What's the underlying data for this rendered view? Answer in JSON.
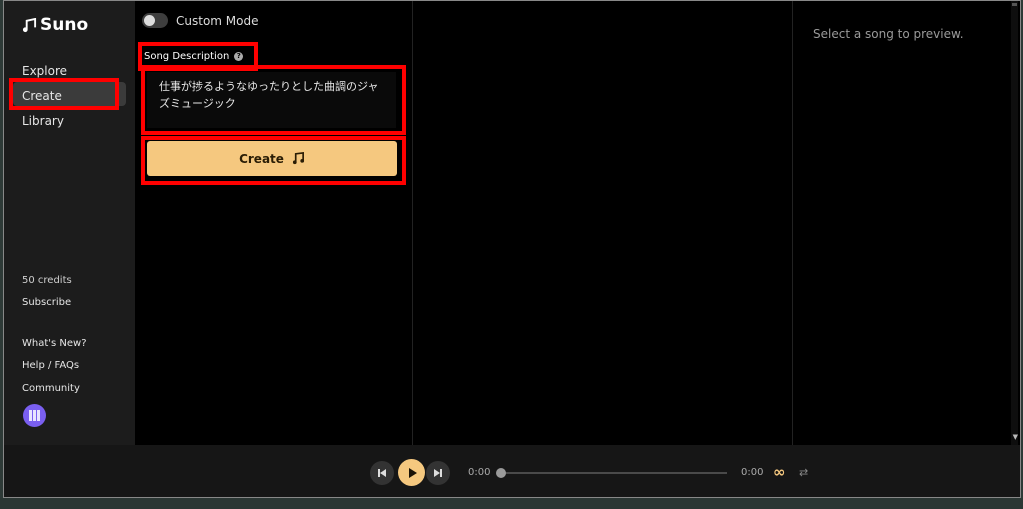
{
  "app": {
    "name": "Suno"
  },
  "sidebar": {
    "items": [
      {
        "label": "Explore"
      },
      {
        "label": "Create"
      },
      {
        "label": "Library"
      }
    ],
    "credits": "50 credits",
    "subscribe": "Subscribe",
    "links": [
      {
        "label": "What's New?"
      },
      {
        "label": "Help / FAQs"
      },
      {
        "label": "Community"
      }
    ]
  },
  "create_panel": {
    "mode_label": "Custom Mode",
    "mode_on": false,
    "description_label": "Song Description",
    "help_glyph": "?",
    "description_value": "仕事が捗るようなゆったりとした曲調のジャズミュージック",
    "create_button": "Create"
  },
  "preview": {
    "placeholder": "Select a song to preview."
  },
  "player": {
    "current_time": "0:00",
    "total_time": "0:00",
    "progress": 0
  },
  "colors": {
    "accent": "#f5c87f",
    "highlight_box": "#ff0000",
    "avatar": "#7a5ff0"
  }
}
